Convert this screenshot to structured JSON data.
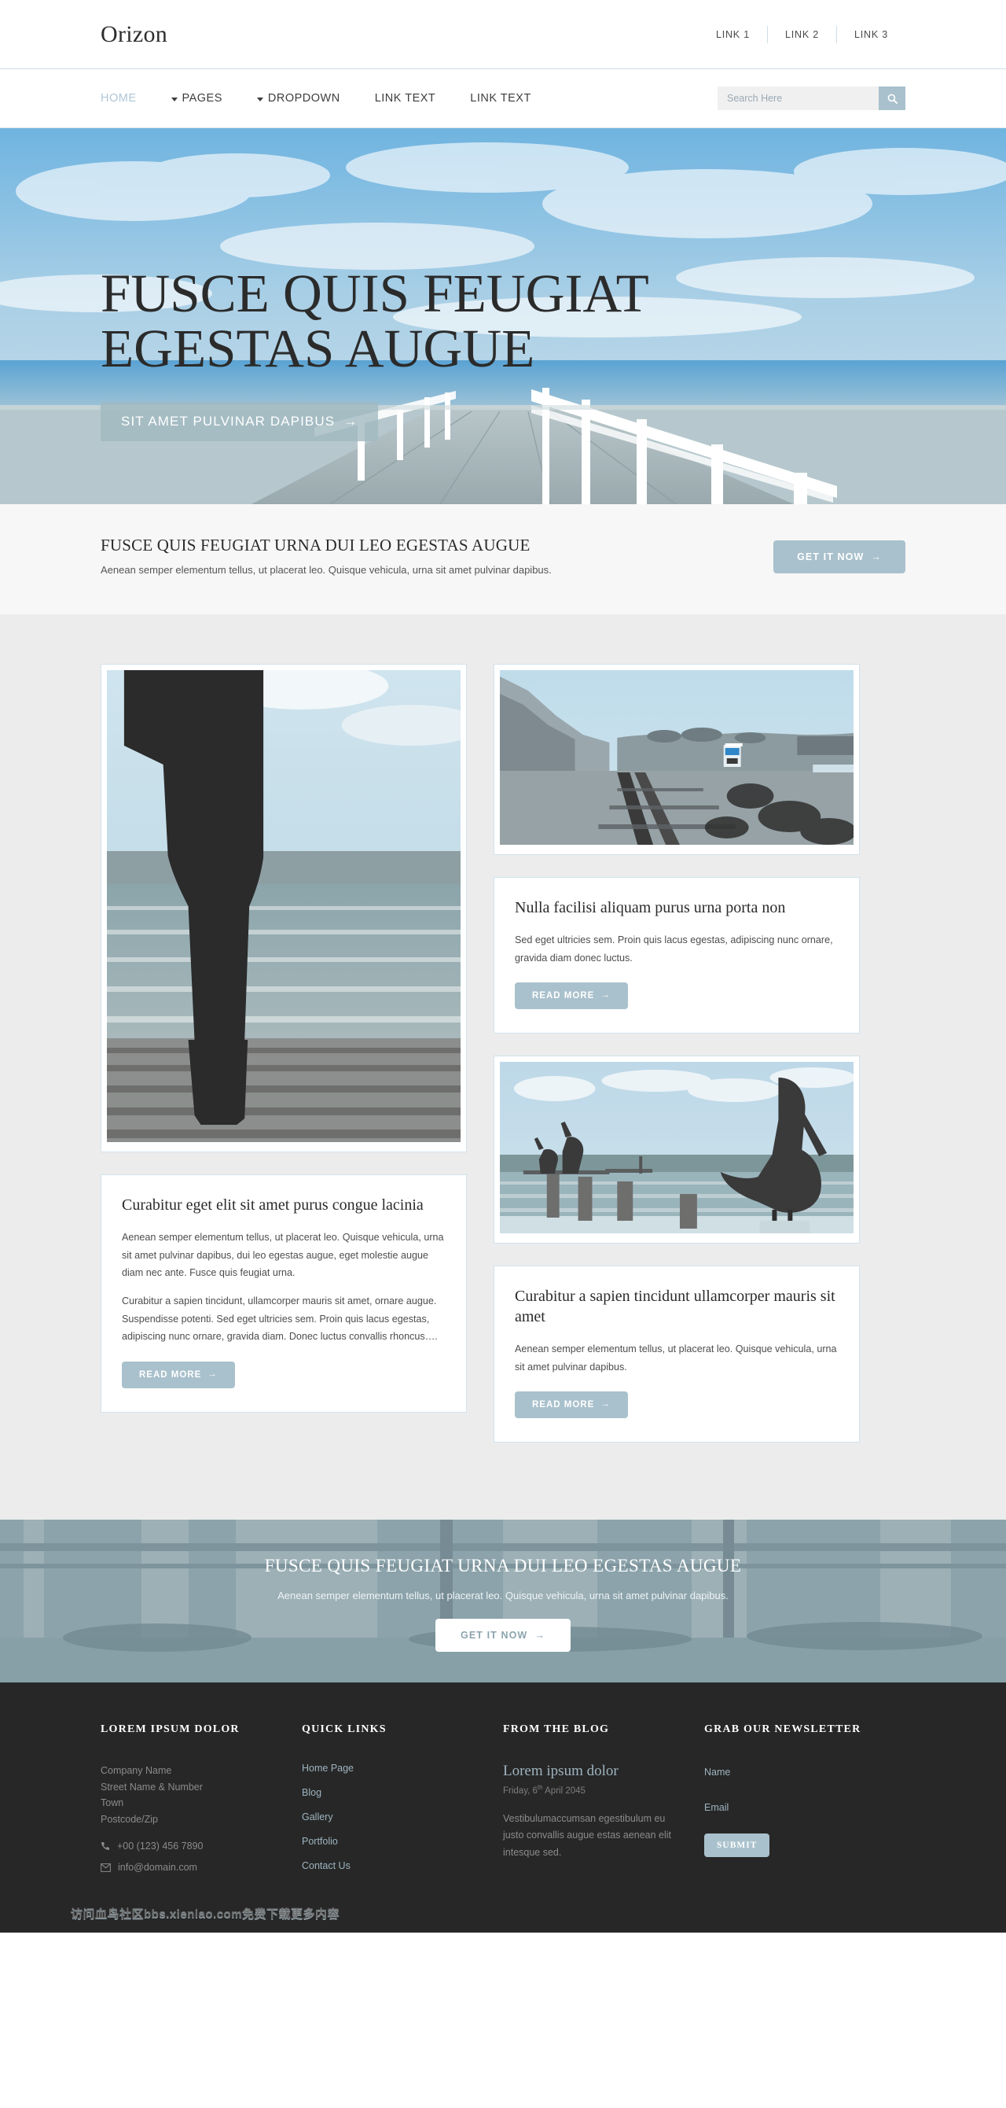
{
  "brand": {
    "logo": "Orizon"
  },
  "topbar": {
    "links": [
      {
        "label": "LINK 1"
      },
      {
        "label": "LINK 2"
      },
      {
        "label": "LINK 3"
      }
    ]
  },
  "nav": {
    "items": [
      {
        "label": "HOME",
        "caret": false,
        "active": true
      },
      {
        "label": "PAGES",
        "caret": true,
        "active": false
      },
      {
        "label": "DROPDOWN",
        "caret": true,
        "active": false
      },
      {
        "label": "LINK TEXT",
        "caret": false,
        "active": false
      },
      {
        "label": "LINK TEXT",
        "caret": false,
        "active": false
      }
    ],
    "search": {
      "placeholder": "Search Here",
      "value": "",
      "icon": "search-icon"
    }
  },
  "hero": {
    "title": "FUSCE QUIS FEUGIAT EGESTAS AUGUE",
    "button": "SIT AMET PULVINAR DAPIBUS",
    "arrow": "→"
  },
  "intro": {
    "title": "FUSCE QUIS FEUGIAT URNA DUI LEO EGESTAS AUGUE",
    "text": "Aenean semper elementum tellus, ut placerat leo. Quisque vehicula, urna sit amet pulvinar dapibus.",
    "button": "GET IT NOW",
    "arrow": "→"
  },
  "cards": {
    "read_more": "READ MORE",
    "arrow": "→",
    "left_feature": {
      "image_alt": "man-standing-on-pier-photo"
    },
    "left_post": {
      "title": "Curabitur eget elit sit amet purus congue lacinia",
      "paragraphs": [
        "Aenean semper elementum tellus, ut placerat leo. Quisque vehicula, urna sit amet pulvinar dapibus, dui leo egestas augue, eget molestie augue diam nec ante. Fusce quis feugiat urna.",
        "Curabitur a sapien tincidunt, ullamcorper mauris sit amet, ornare augue. Suspendisse potenti. Sed eget ultricies sem. Proin quis lacus egestas, adipiscing nunc ornare, gravida diam. Donec luctus convallis rhoncus…."
      ]
    },
    "right_top": {
      "image_alt": "railway-tracks-by-the-coast-photo"
    },
    "right_post_1": {
      "title": "Nulla facilisi aliquam purus urna porta non",
      "paragraphs": [
        "Sed eget ultricies sem. Proin quis lacus egestas, adipiscing nunc ornare, gravida diam donec luctus."
      ]
    },
    "right_mid": {
      "image_alt": "pelicans-on-pier-posts-photo"
    },
    "right_post_2": {
      "title": "Curabitur a sapien tincidunt ullamcorper mauris sit amet",
      "paragraphs": [
        "Aenean semper elementum tellus, ut placerat leo. Quisque vehicula, urna sit amet pulvinar dapibus."
      ]
    }
  },
  "cta": {
    "title": "FUSCE QUIS FEUGIAT URNA DUI LEO EGESTAS AUGUE",
    "text": "Aenean semper elementum tellus, ut placerat leo. Quisque vehicula, urna sit amet pulvinar dapibus.",
    "button": "GET IT NOW",
    "arrow": "→"
  },
  "footer": {
    "about": {
      "heading": "LOREM IPSUM DOLOR",
      "address": "Company Name\nStreet Name & Number\nTown\nPostcode/Zip",
      "phone": "+00 (123) 456 7890",
      "email": "info@domain.com",
      "phone_icon": "phone-icon",
      "email_icon": "envelope-icon"
    },
    "quick_links": {
      "heading": "QUICK LINKS",
      "items": [
        {
          "label": "Home Page"
        },
        {
          "label": "Blog"
        },
        {
          "label": "Gallery"
        },
        {
          "label": "Portfolio"
        },
        {
          "label": "Contact Us"
        }
      ]
    },
    "blog": {
      "heading": "FROM THE BLOG",
      "post_title": "Lorem ipsum dolor",
      "date_prefix": "Friday, 6",
      "date_sup": "th",
      "date_suffix": " April 2045",
      "excerpt": "Vestibulumaccumsan egestibulum eu justo convallis augue estas aenean elit intesque sed."
    },
    "newsletter": {
      "heading": "GRAB OUR NEWSLETTER",
      "name_placeholder": "Name",
      "name_value": "",
      "email_placeholder": "Email",
      "email_value": "",
      "submit": "SUBMIT"
    },
    "watermark": "访问血鸟社区bbs.xienlao.com免费下载更多内容"
  },
  "colors": {
    "accent": "#a9c1cc",
    "footer_bg": "#272727",
    "content_bg": "#ececec",
    "nav_active": "#aec6d6"
  }
}
